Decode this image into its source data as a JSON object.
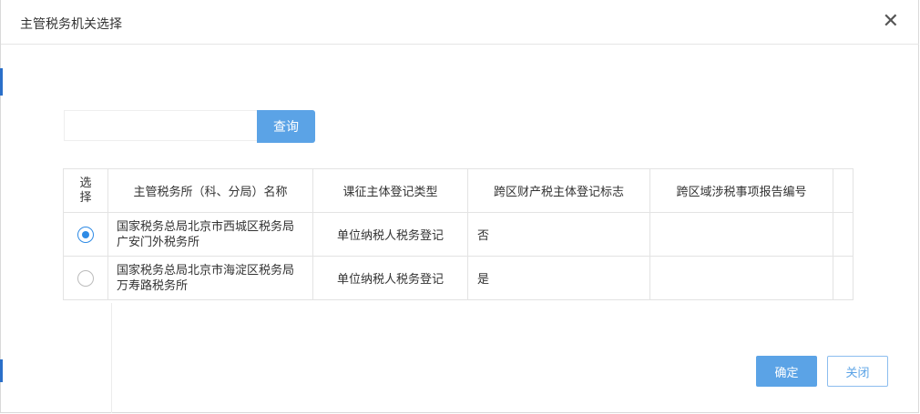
{
  "dialog": {
    "title": "主管税务机关选择",
    "close_glyph": "✕"
  },
  "search": {
    "value": "",
    "placeholder": "",
    "button_label": "查询"
  },
  "table": {
    "headers": {
      "select": "选择",
      "name": "主管税务所（科、分局）名称",
      "type": "课征主体登记类型",
      "flag": "跨区财产税主体登记标志",
      "report_no": "跨区域涉税事项报告编号"
    },
    "rows": [
      {
        "selected": true,
        "name": "国家税务总局北京市西城区税务局广安门外税务所",
        "type": "单位纳税人税务登记",
        "flag": "否",
        "report_no": ""
      },
      {
        "selected": false,
        "name": "国家税务总局北京市海淀区税务局万寿路税务所",
        "type": "单位纳税人税务登记",
        "flag": "是",
        "report_no": ""
      }
    ]
  },
  "footer": {
    "confirm_label": "确定",
    "close_label": "关闭"
  },
  "colors": {
    "accent": "#5ba3e6",
    "radio_selected": "#2f8be5"
  }
}
